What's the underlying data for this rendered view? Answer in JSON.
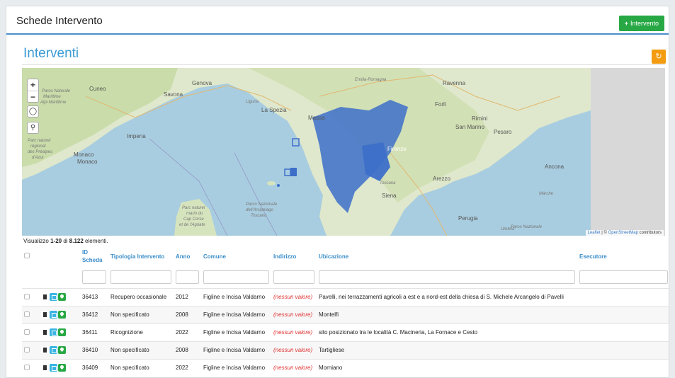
{
  "header": {
    "title": "Schede Intervento",
    "add_button_label": "Intervento"
  },
  "section": {
    "title": "Interventi"
  },
  "map": {
    "attribution_link1": "Leaflet",
    "attribution_sep": " | © ",
    "attribution_link2": "OpenStreetMap",
    "attribution_tail": " contributors",
    "labels": {
      "cuneo": "Cuneo",
      "genova": "Genova",
      "savona": "Savona",
      "imperia": "Imperia",
      "monaco": "Monaco",
      "monaco2": "Monaco",
      "laspezia": "La Spezia",
      "massa": "Massa",
      "ravenna": "Ravenna",
      "forli": "Forlì",
      "sanmarino": "San Marino",
      "pesaro": "Pesaro",
      "rimini": "Rimini",
      "ancona": "Ancona",
      "arezzo": "Arezzo",
      "siena": "Siena",
      "toscana": "Toscana",
      "perugia": "Perugia",
      "marche": "Marche",
      "umbria": "Umbria",
      "liguria": "Liguria",
      "emilia": "Emilia-Romagna",
      "firenze": "Firenze",
      "parc1": "Parc naturel",
      "parc2": "marin du",
      "parc3": "Cap Corse",
      "parc4": "et de l'Agriate",
      "pn1": "Parco Nazionale",
      "pn2": "dell'Arcipelago",
      "pn3": "Toscano",
      "pnright": "Parco Nazionale",
      "pnl1": "Parc naturel",
      "pnl2": "régional",
      "pnl3": "des Préalpes",
      "pnl4": "d'Azur",
      "pml1": "Parco Naturale",
      "pml2": "Marittime",
      "pml3": "Alpi Marittime"
    }
  },
  "count": {
    "prefix": "Visualizzo ",
    "range": "1-20",
    "mid": " di ",
    "total": "8.122",
    "suffix": " elementi."
  },
  "table": {
    "headers": {
      "id": "ID\nScheda",
      "tipologia": "Tipologia Intervento",
      "anno": "Anno",
      "comune": "Comune",
      "indirizzo": "Indirizzo",
      "ubicazione": "Ubicazione",
      "esecutore": "Esecutore"
    },
    "rows": [
      {
        "id": "36413",
        "tipologia": "Recupero occasionale",
        "anno": "2012",
        "comune": "Figline e Incisa Valdarno",
        "indirizzo": "(nessun valore)",
        "ubicazione": "Pavelli, nei terrazzamenti agricoli a est e a nord-est della chiesa di S. Michele Arcangelo di Pavelli"
      },
      {
        "id": "36412",
        "tipologia": "Non specificato",
        "anno": "2008",
        "comune": "Figline e Incisa Valdarno",
        "indirizzo": "(nessun valore)",
        "ubicazione": "Montelfi"
      },
      {
        "id": "36411",
        "tipologia": "Ricognizione",
        "anno": "2022",
        "comune": "Figline e Incisa Valdarno",
        "indirizzo": "(nessun valore)",
        "ubicazione": "sito posizionato tra le località C. Macineria, La Fornace e Cesto"
      },
      {
        "id": "36410",
        "tipologia": "Non specificato",
        "anno": "2008",
        "comune": "Figline e Incisa Valdarno",
        "indirizzo": "(nessun valore)",
        "ubicazione": "Tartigliese"
      },
      {
        "id": "36409",
        "tipologia": "Non specificato",
        "anno": "2022",
        "comune": "Figline e Incisa Valdarno",
        "indirizzo": "(nessun valore)",
        "ubicazione": "Morniano"
      }
    ]
  },
  "colors": {
    "accent": "#3a9bd5",
    "add": "#27a844",
    "refresh": "#f39c12",
    "marker": "#3d6fc9",
    "null": "#e03030"
  }
}
